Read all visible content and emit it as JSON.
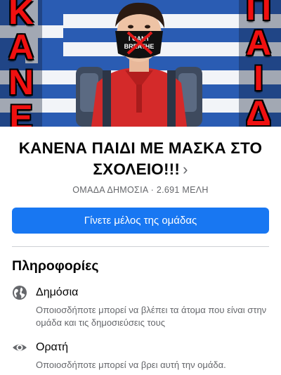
{
  "cover": {
    "left_word": [
      "Κ",
      "Α",
      "Ν",
      "Ε"
    ],
    "right_word": [
      "Π",
      "Α",
      "Ι",
      "Δ"
    ],
    "mask_text": "I CANT BREATHE"
  },
  "group": {
    "title": "ΚΑΝΕΝΑ ΠΑΙΔΙ ΜΕ ΜΑΣΚΑ ΣΤΟ ΣΧΟΛΕΙΟ!!!",
    "chevron": "›",
    "privacy_label": "ΟΜΑΔΑ ΔΗΜΟΣΙΑ",
    "separator": "·",
    "members_label": "2.691 ΜΕΛΗ"
  },
  "join_button": {
    "label": "Γίνετε μέλος της ομάδας"
  },
  "info": {
    "title": "Πληροφορίες",
    "items": [
      {
        "icon": "globe-icon",
        "label": "Δημόσια",
        "description": "Οποιοσδήποτε μπορεί να βλέπει τα άτομα που είναι στην ομάδα και τις δημοσιεύσεις τους"
      },
      {
        "icon": "eye-icon",
        "label": "Ορατή",
        "description": "Οποιοσδήποτε μπορεί να βρει αυτή την ομάδα."
      }
    ]
  },
  "colors": {
    "accent": "#1877f2",
    "flag_blue": "#1d4fa5",
    "secondary_text": "#65676b"
  }
}
